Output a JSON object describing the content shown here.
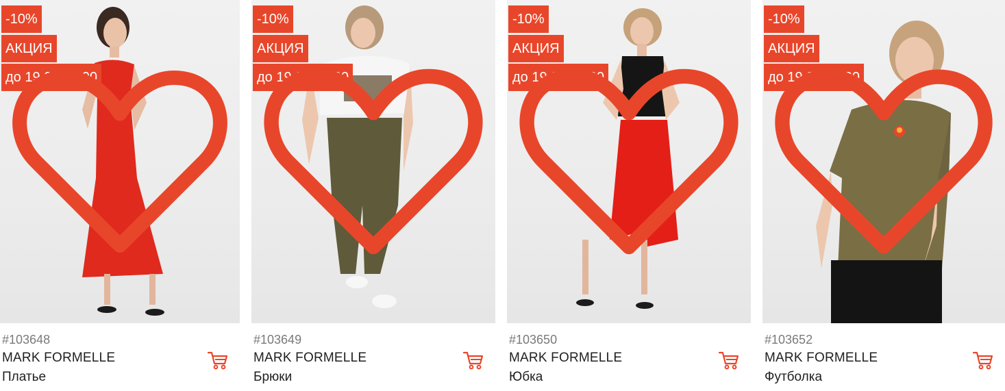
{
  "colors": {
    "accent": "#e8462a"
  },
  "products": [
    {
      "discount": "-10%",
      "promo": "АКЦИЯ",
      "until": "до 19.04 12:00",
      "sku": "#103648",
      "brand": "MARK FORMELLE",
      "title": "Платье",
      "icon_fav": "heart-outline-icon",
      "icon_cart": "cart-icon"
    },
    {
      "discount": "-10%",
      "promo": "АКЦИЯ",
      "until": "до 19.04 12:00",
      "sku": "#103649",
      "brand": "MARK FORMELLE",
      "title": "Брюки",
      "icon_fav": "heart-outline-icon",
      "icon_cart": "cart-icon"
    },
    {
      "discount": "-10%",
      "promo": "АКЦИЯ",
      "until": "до 19.04 12:00",
      "sku": "#103650",
      "brand": "MARK FORMELLE",
      "title": "Юбка",
      "icon_fav": "heart-outline-icon",
      "icon_cart": "cart-icon"
    },
    {
      "discount": "-10%",
      "promo": "АКЦИЯ",
      "until": "до 19.04 12:00",
      "sku": "#103652",
      "brand": "MARK FORMELLE",
      "title": "Футболка",
      "icon_fav": "heart-outline-icon",
      "icon_cart": "cart-icon"
    }
  ]
}
